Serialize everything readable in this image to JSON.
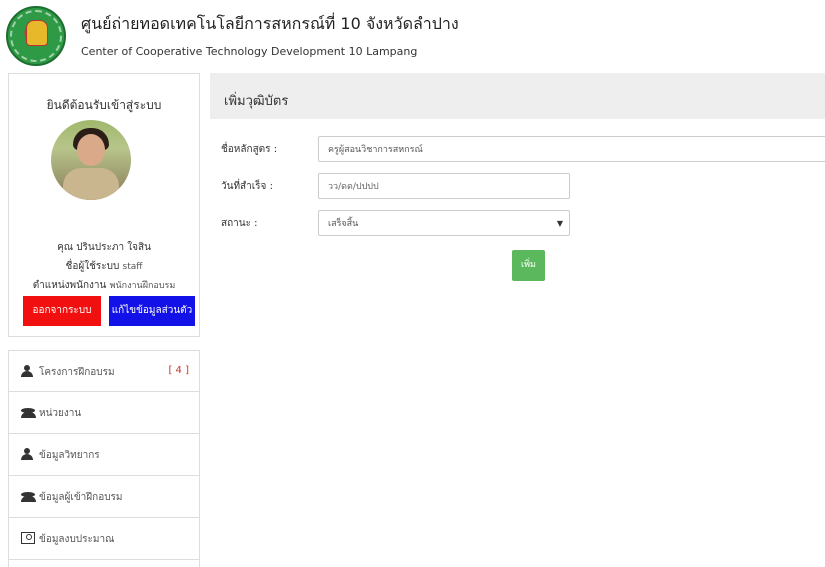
{
  "header": {
    "title": "ศูนย์ถ่ายทอดเทคโนโลยีการสหกรณ์ที่ 10 จังหวัดลำปาง",
    "subtitle": "Center of Cooperative Technology Development 10 Lampang"
  },
  "profile": {
    "welcome": "ยินดีต้อนรับเข้าสู่ระบบ",
    "name": "คุณ ปรินประภา ใจสิน",
    "user_label": "ชื่อผู้ใช้ระบบ",
    "user_value": "staff",
    "position_label": "ตำแหน่งพนักงาน",
    "position_value": "พนักงานฝึกอบรม",
    "logout_label": "ออกจากระบบ",
    "edit_label": "แก้ไขข้อมูลส่วนตัว"
  },
  "menu": {
    "items": [
      {
        "label": "โครงการฝึกอบรม",
        "icon": "user-icon",
        "count": "[ 4 ]"
      },
      {
        "label": "หน่วยงาน",
        "icon": "group-icon"
      },
      {
        "label": "ข้อมูลวิทยากร",
        "icon": "user-icon"
      },
      {
        "label": "ข้อมูลผู้เข้าฝึกอบรม",
        "icon": "group-icon"
      },
      {
        "label": "ข้อมูลงบประมาณ",
        "icon": "money-icon"
      }
    ]
  },
  "main": {
    "title": "เพิ่มวุฒิบัตร",
    "course_label": "ชื่อหลักสูตร :",
    "course_value": "ครูผู้สอนวิชาการสหกรณ์",
    "date_label": "วันที่สำเร็จ :",
    "date_placeholder": "วว/ดด/ปปปป",
    "status_label": "สถานะ :",
    "status_value": "เสร็จสิ้น",
    "add_label": "เพิ่ม"
  },
  "colors": {
    "logout_bg": "#f20f0f",
    "edit_bg": "#1212e8",
    "add_bg": "#5cb85c",
    "count_color": "#c0392b"
  }
}
